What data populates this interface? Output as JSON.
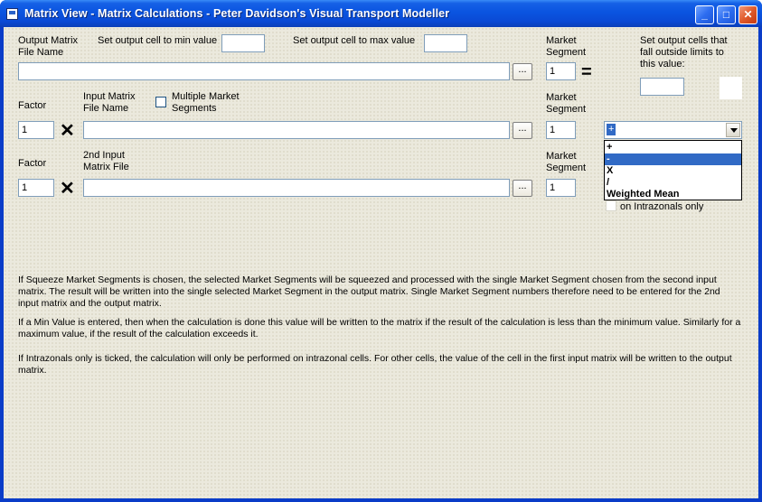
{
  "window": {
    "title": "Matrix View - Matrix Calculations - Peter Davidson's Visual Transport Modeller",
    "minimize": "_",
    "maximize": "□",
    "close": "✕"
  },
  "output": {
    "file_label_1": "Output Matrix",
    "file_label_2": "File Name",
    "file_value": "",
    "min_label": "Set output cell to min value",
    "min_value": "",
    "max_label": "Set output cell to max value",
    "max_value": "",
    "segment_label_1": "Market",
    "segment_label_2": "Segment",
    "segment_value": "1",
    "limits_label_1": "Set output cells that",
    "limits_label_2": "fall outside limits to",
    "limits_label_3": "this value:",
    "limits_value": ""
  },
  "input1": {
    "factor_label": "Factor",
    "factor_value": "1",
    "file_label_1": "Input Matrix",
    "file_label_2": "File Name",
    "file_value": "",
    "multi_label_1": "Multiple Market",
    "multi_label_2": "Segments",
    "segment_label_1": "Market",
    "segment_label_2": "Segment",
    "segment_value": "1"
  },
  "input2": {
    "factor_label": "Factor",
    "factor_value": "1",
    "file_label_1": "2nd Input",
    "file_label_2": "Matrix File",
    "file_value": "",
    "segment_label_1": "Market",
    "segment_label_2": "Segment",
    "segment_value": "1"
  },
  "browse_label": "...",
  "times_symbol": "✕",
  "equals_symbol": "=",
  "operator": {
    "selected": "+",
    "options": [
      "+",
      "-",
      "X",
      "/",
      "Weighted Mean"
    ],
    "highlighted_index": 1
  },
  "intrazonal_label": "on Intrazonals only",
  "help": {
    "para1": "If Squeeze Market Segments is chosen, the selected Market Segments will be squeezed and processed with the single Market Segment chosen from the second input matrix.  The result will be written into the single selected Market Segment in the output matrix.  Single Market Segment numbers therefore need to be entered for the 2nd input matrix and the output matrix.",
    "para2": "If a Min Value is entered, then when the calculation is done this value will be written to the matrix if the result of the calculation is less than the minimum value. Similarly for a maximum value, if the result of the calculation exceeds it.",
    "para3": "If Intrazonals only is ticked, the calculation will only be performed on intrazonal cells. For other cells, the value of the cell in the first input matrix will be written to the output matrix."
  }
}
